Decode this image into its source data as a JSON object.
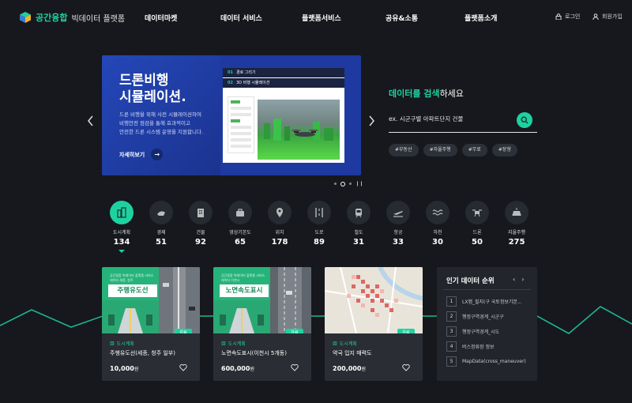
{
  "header": {
    "logo_primary": "공간융합",
    "logo_secondary": "빅데이터 플랫폼",
    "nav": [
      "데이터마켓",
      "데이터 서비스",
      "플랫폼서비스",
      "공유&소통",
      "플랫폼소개"
    ],
    "login": "로그인",
    "signup": "회원가입"
  },
  "banner": {
    "title_line1": "드론비행",
    "title_line2": "시뮬레이션.",
    "desc_line1": "드론 비행을 위해 사전 시뮬레이션하여",
    "desc_line2": "비행안전 점검을 통해 효과적이고",
    "desc_line3": "안전한 드론 시스템 운영을 지원합니다.",
    "button": "자세히보기",
    "step1_num": "01",
    "step1_label": "경로 그리기",
    "step2_num": "02",
    "step2_label": "3D 비행 시뮬레이션",
    "slide_count": 3,
    "active_slide": 2
  },
  "search": {
    "title_accent": "데이터를 검색",
    "title_rest": "하세요",
    "placeholder": "ex. 시군구별 아파트단지 건물",
    "tags": [
      "#부동산",
      "#자율주행",
      "#무료",
      "#장형"
    ]
  },
  "categories": [
    {
      "label": "도시계획",
      "count": "134",
      "icon": "city-icon",
      "active": true
    },
    {
      "label": "경제",
      "count": "51",
      "icon": "economy-icon"
    },
    {
      "label": "건물",
      "count": "92",
      "icon": "building-icon"
    },
    {
      "label": "영상기본도",
      "count": "65",
      "icon": "map-image-icon"
    },
    {
      "label": "위치",
      "count": "178",
      "icon": "location-icon"
    },
    {
      "label": "도로",
      "count": "89",
      "icon": "road-icon"
    },
    {
      "label": "철도",
      "count": "31",
      "icon": "train-icon"
    },
    {
      "label": "항공",
      "count": "33",
      "icon": "airplane-icon"
    },
    {
      "label": "하천",
      "count": "30",
      "icon": "river-icon"
    },
    {
      "label": "드론",
      "count": "50",
      "icon": "drone-icon"
    },
    {
      "label": "지율주행",
      "count": "275",
      "icon": "car-icon"
    }
  ],
  "products": [
    {
      "thumb_caption": "공간융합 빅데이터 플랫폼 서비스 데이터 세종, 청주",
      "thumb_title": "주행유도선",
      "badge": "유료",
      "category": "도시계획",
      "name": "주행유도선(세종, 청주 일부)",
      "price": "10,000",
      "unit": "원"
    },
    {
      "thumb_caption": "공간융합 빅데이터 플랫폼 서비스 데이터 이천시",
      "thumb_title": "노면속도표시",
      "badge": "유료",
      "category": "도시계획",
      "name": "노면속도표시(이천시 5개동)",
      "price": "600,000",
      "unit": "원"
    },
    {
      "badge": "유료",
      "category": "도시계획",
      "name": "약국 입지 매력도",
      "price": "200,000",
      "unit": "원"
    }
  ],
  "ranking": {
    "title": "인기 데이터 순위",
    "prev": "‹",
    "next": "›",
    "items": [
      {
        "num": "1",
        "text": "LX맵_필지(구 국토정보기본..."
      },
      {
        "num": "2",
        "text": "행정구역경계_시군구"
      },
      {
        "num": "3",
        "text": "행정구역경계_시도"
      },
      {
        "num": "4",
        "text": "버스정류장 정보"
      },
      {
        "num": "5",
        "text": "MapData(cross_maneuver)"
      }
    ]
  },
  "colors": {
    "accent": "#1fd1a0",
    "background": "#16181d",
    "banner": "#1e3aa0",
    "card": "#2a2d33"
  }
}
